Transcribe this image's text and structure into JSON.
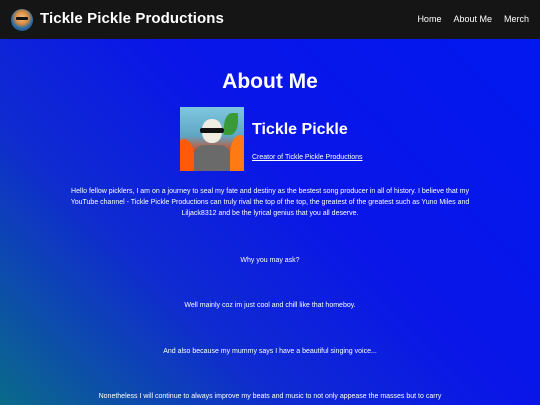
{
  "header": {
    "brand": "Tickle Pickle Productions",
    "nav": [
      {
        "label": "Home"
      },
      {
        "label": "About Me"
      },
      {
        "label": "Merch"
      }
    ]
  },
  "main": {
    "title": "About Me",
    "profile": {
      "name": "Tickle Pickle",
      "link_text": "Creator of Tickle Pickle Productions"
    },
    "paragraphs": [
      "Hello fellow picklers, I am on a journey to seal my fate and destiny as the bestest song producer in all of history. I believe that my YouTube channel - Tickle Pickle Productions can truly rival the top of the top, the greatest of the greatest such as Yuno Miles and Liljack8312 and be the lyrical genius that you all deserve.",
      "Why you may ask?",
      "Well mainly coz im just cool and chill like that homeboy.",
      "And also because my mummy says I have a beautiful singing voice...",
      "Nonetheless I will continue to always improve my beats and music to not only appease the masses but to carry"
    ]
  }
}
